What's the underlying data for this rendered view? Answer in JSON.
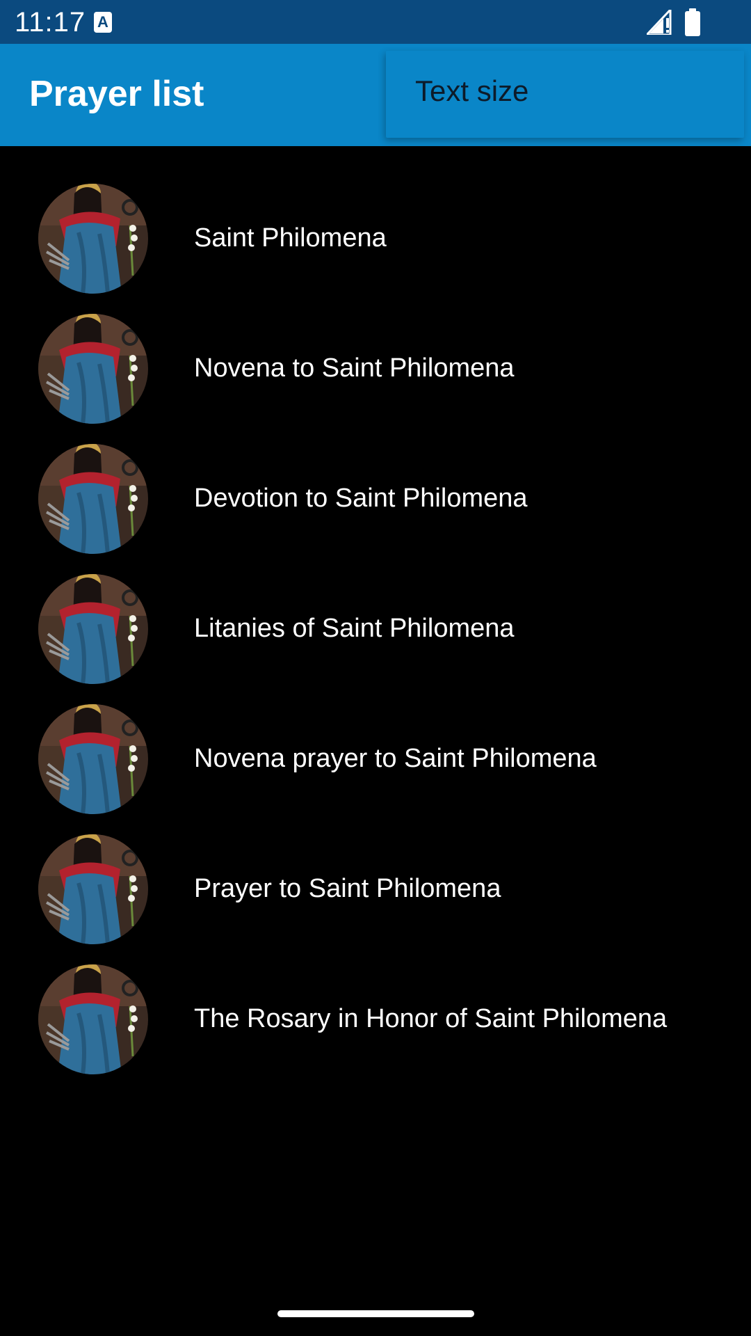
{
  "status_bar": {
    "time": "11:17",
    "notification_icon": "keyboard-a-icon",
    "signal_icon": "signal-alert-icon",
    "battery_icon": "battery-icon"
  },
  "app_bar": {
    "title": "Prayer list",
    "background_color": "#0a86c8"
  },
  "popup_menu": {
    "items": [
      {
        "label": "Text size"
      }
    ]
  },
  "prayer_list": {
    "items": [
      {
        "label": "Saint Philomena",
        "icon": "saint-philomena-avatar"
      },
      {
        "label": "Novena to Saint Philomena",
        "icon": "saint-philomena-avatar"
      },
      {
        "label": "Devotion to Saint Philomena",
        "icon": "saint-philomena-avatar"
      },
      {
        "label": "Litanies of Saint Philomena",
        "icon": "saint-philomena-avatar"
      },
      {
        "label": "Novena prayer to Saint Philomena",
        "icon": "saint-philomena-avatar"
      },
      {
        "label": "Prayer to Saint Philomena",
        "icon": "saint-philomena-avatar"
      },
      {
        "label": "The Rosary in Honor of Saint Philomena",
        "icon": "saint-philomena-avatar"
      }
    ]
  },
  "colors": {
    "status_bar": "#0b4a7f",
    "app_bar": "#0a86c8",
    "list_background": "#000000",
    "list_text": "#ffffff"
  }
}
